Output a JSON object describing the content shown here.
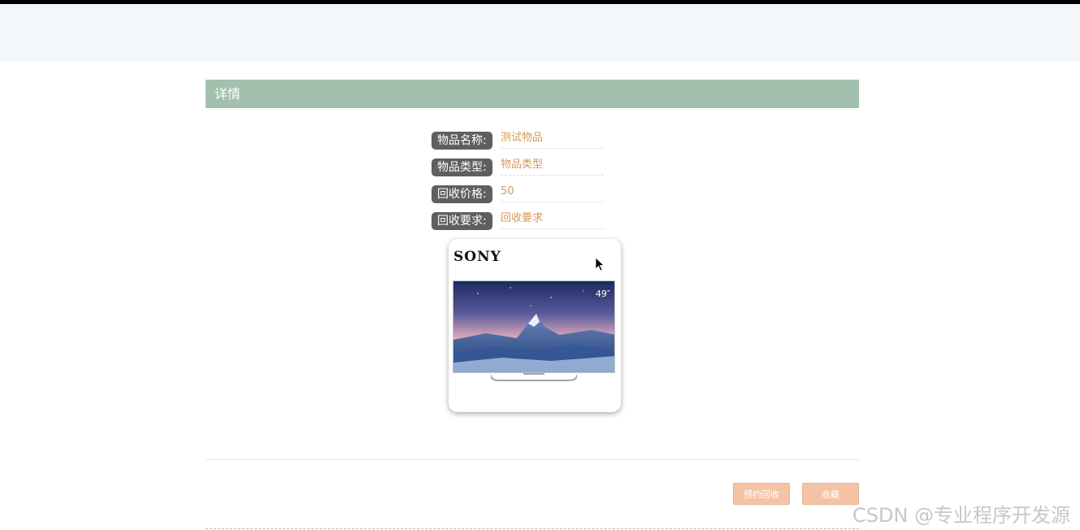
{
  "section": {
    "title": "详情"
  },
  "fields": [
    {
      "label": "物品名称:",
      "value": "测试物品"
    },
    {
      "label": "物品类型:",
      "value": "物品类型"
    },
    {
      "label": "回收价格:",
      "value": "50"
    },
    {
      "label": "回收要求:",
      "value": "回收要求"
    }
  ],
  "product_image": {
    "brand": "SONY",
    "screen_size": "49″",
    "icon": "tv-product-photo"
  },
  "buttons": {
    "reserve_label": "预约回收",
    "favorite_label": "收藏"
  },
  "watermark": "CSDN @专业程序开发源",
  "colors": {
    "section_bar": "#a3bfad",
    "label_bg": "#5f5f5f",
    "value_text": "#d49a5a",
    "button_bg": "#f5c3a4"
  }
}
